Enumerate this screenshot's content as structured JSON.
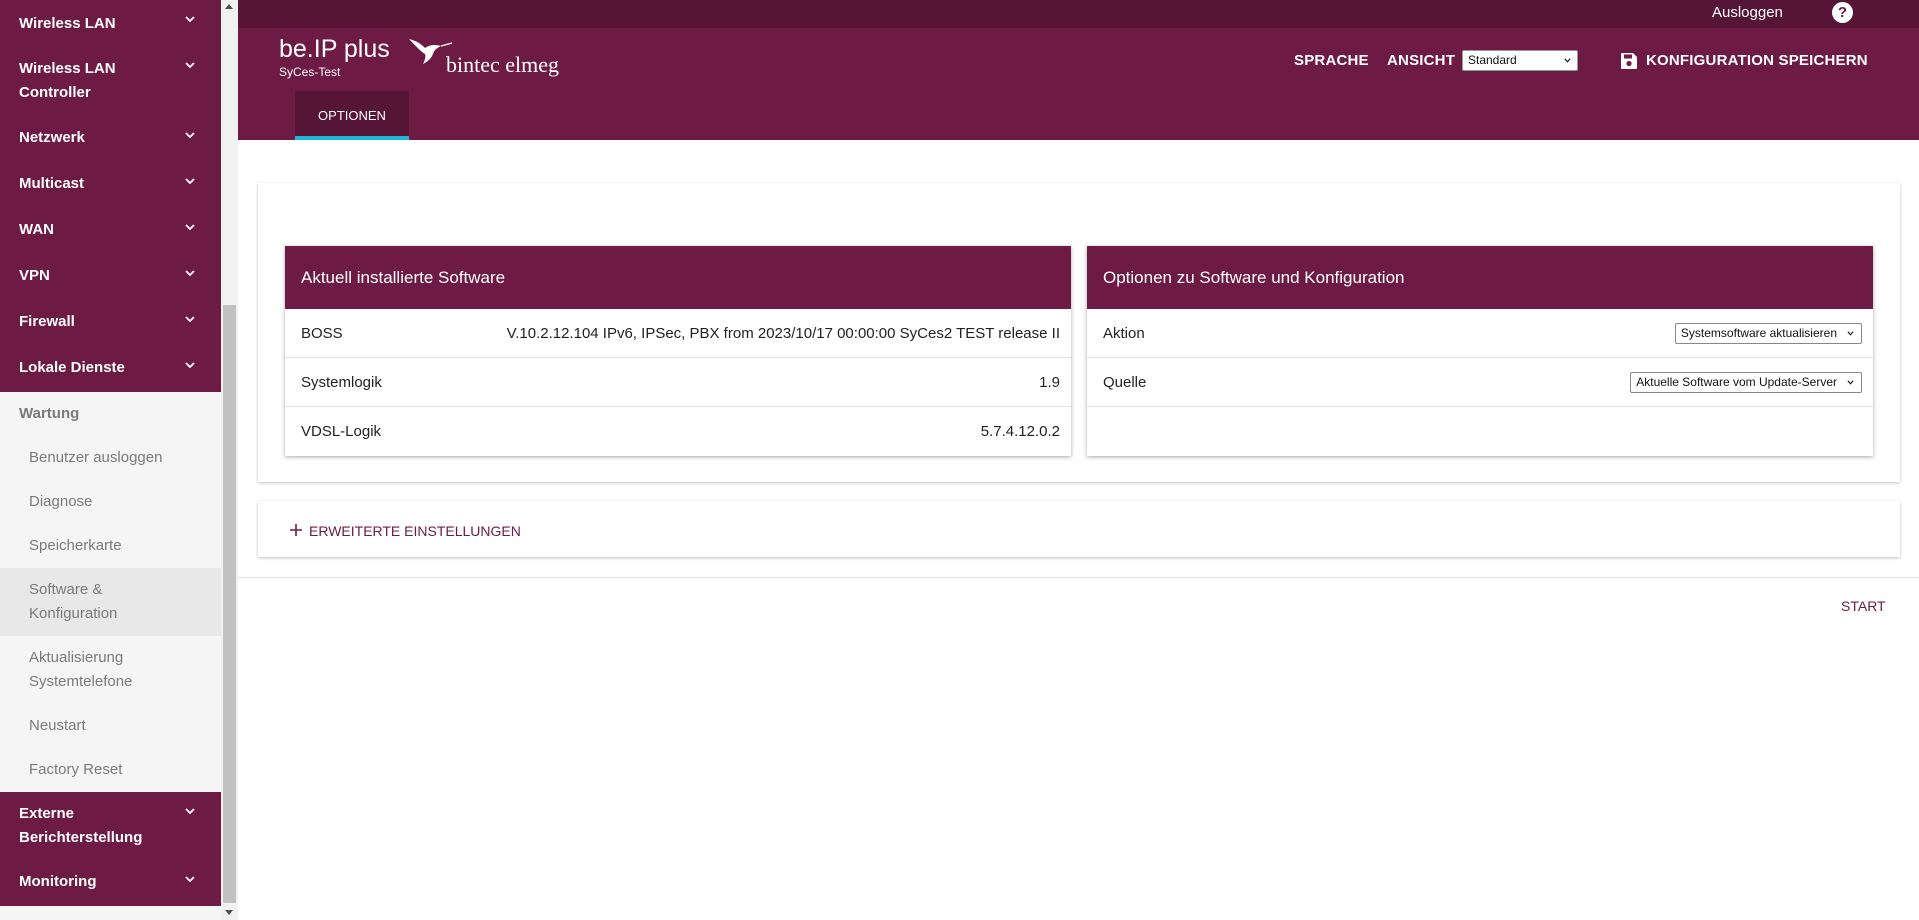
{
  "header": {
    "logout_label": "Ausloggen",
    "help_label": "?",
    "product_name": "be.IP plus",
    "device_name": "SyCes-Test",
    "brand_logo_text": "bintec elmeg",
    "language_label": "SPRACHE",
    "view_label": "ANSICHT",
    "view_value": "Standard",
    "save_config_label": "KONFIGURATION SPEICHERN",
    "tab_label": "OPTIONEN"
  },
  "sidebar": {
    "groups_top": [
      {
        "label": "Wireless LAN",
        "icon": "chevron-down-icon"
      },
      {
        "label": "Wireless LAN Controller",
        "icon": "chevron-down-icon"
      },
      {
        "label": "Netzwerk",
        "icon": "chevron-down-icon"
      },
      {
        "label": "Multicast",
        "icon": "chevron-down-icon"
      },
      {
        "label": "WAN",
        "icon": "chevron-down-icon"
      },
      {
        "label": "VPN",
        "icon": "chevron-down-icon"
      },
      {
        "label": "Firewall",
        "icon": "chevron-down-icon"
      },
      {
        "label": "Lokale Dienste",
        "icon": "chevron-down-icon"
      }
    ],
    "open_group": "Wartung",
    "sub_items": [
      "Benutzer ausloggen",
      "Diagnose",
      "Speicherkarte",
      "Software & Konfiguration",
      "Aktualisierung Systemtelefone",
      "Neustart",
      "Factory Reset"
    ],
    "active_sub_item": "Software & Konfiguration",
    "groups_bottom": [
      {
        "label": "Externe Berichterstellung",
        "icon": "chevron-down-icon"
      },
      {
        "label": "Monitoring",
        "icon": "chevron-down-icon"
      }
    ]
  },
  "installed": {
    "title": "Aktuell installierte Software",
    "rows": [
      {
        "label": "BOSS",
        "value": "V.10.2.12.104 IPv6, IPSec, PBX from 2023/10/17 00:00:00 SyCes2 TEST release II"
      },
      {
        "label": "Systemlogik",
        "value": "1.9"
      },
      {
        "label": "VDSL-Logik",
        "value": "5.7.4.12.0.2"
      }
    ]
  },
  "options": {
    "title": "Optionen zu Software und Konfiguration",
    "action_label": "Aktion",
    "action_value": "Systemsoftware aktualisieren",
    "source_label": "Quelle",
    "source_value": "Aktuelle Software vom Update-Server"
  },
  "advanced_label": "ERWEITERTE EINSTELLUNGEN",
  "start_label": "START",
  "colors": {
    "brand": "#6d1a44",
    "brand_dark": "#561437",
    "tab_accent": "#21b5d6",
    "sidebar_bg": "#f5f5f5"
  }
}
